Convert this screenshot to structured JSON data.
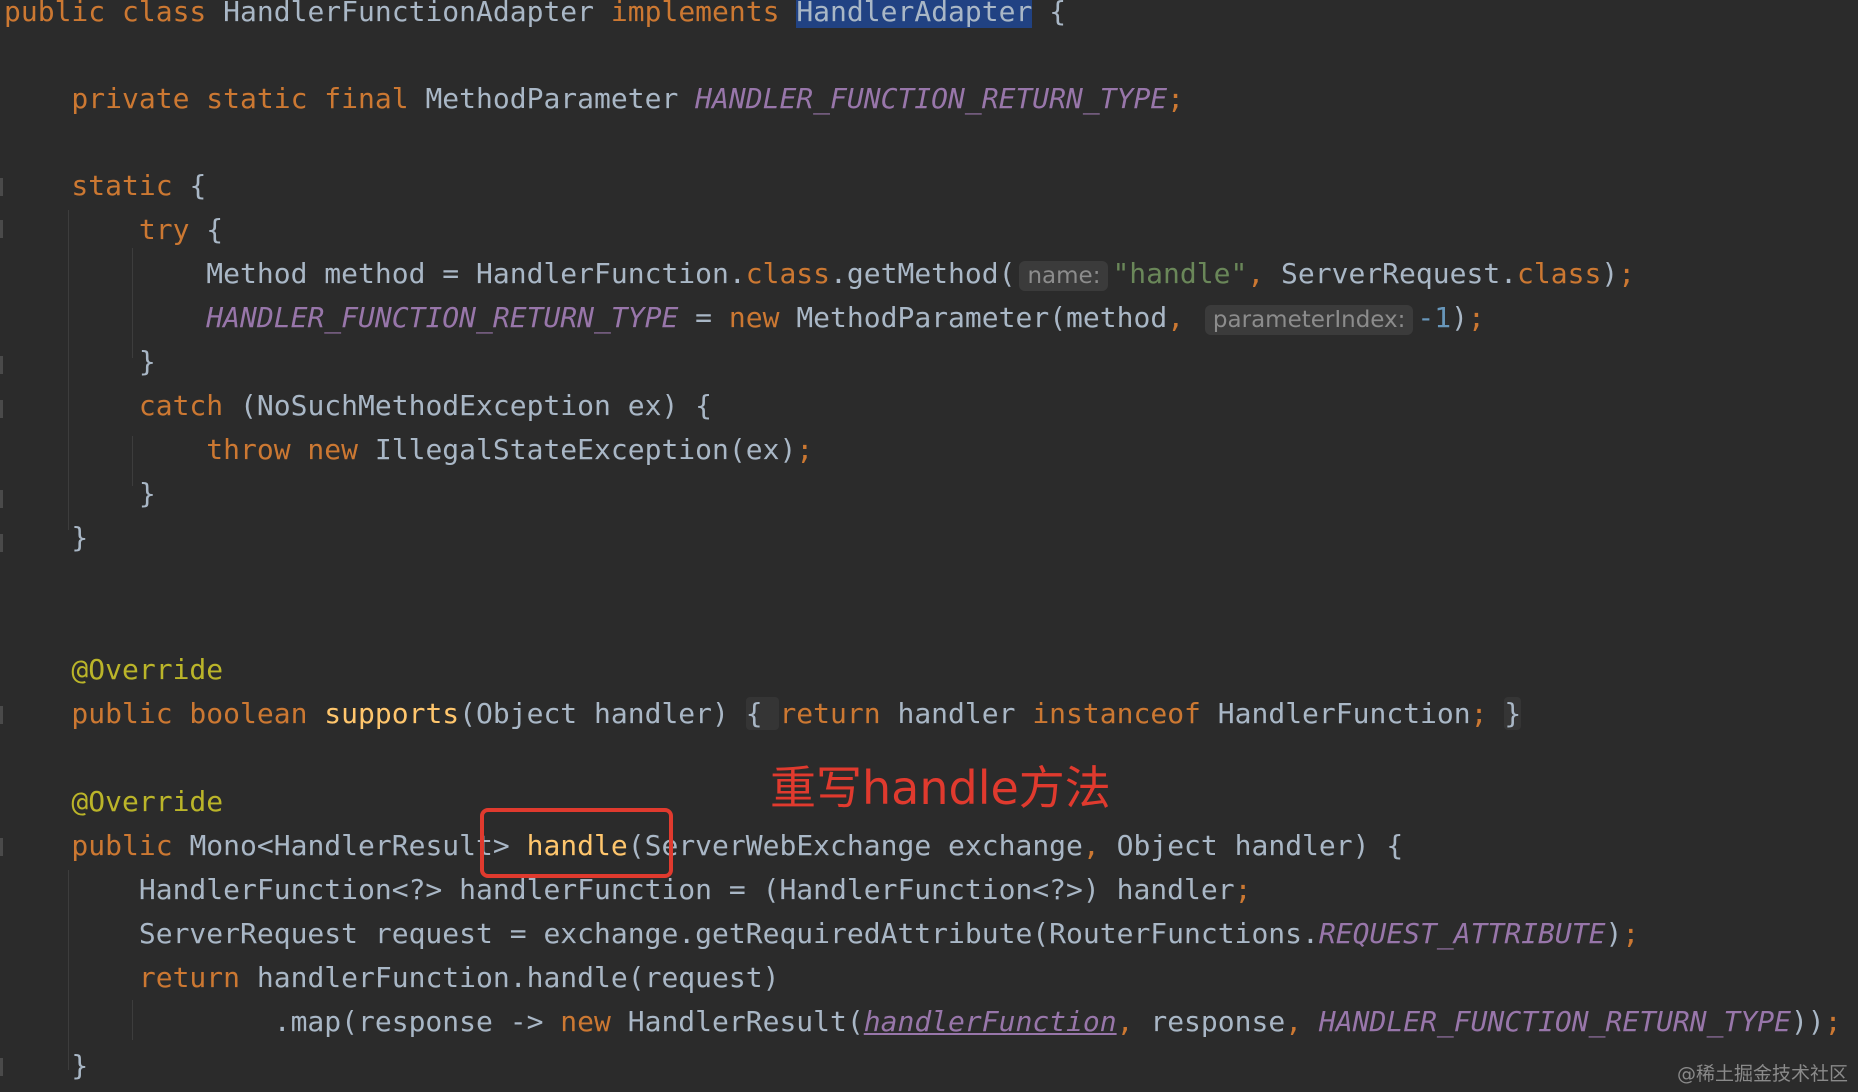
{
  "code_lines": [
    {
      "segments": [
        {
          "text": "public class ",
          "type": "kw"
        },
        {
          "text": "HandlerFunctionAdapter ",
          "type": "txt"
        },
        {
          "text": "implements ",
          "type": "kw"
        },
        {
          "text": "HandlerAdapter",
          "type": "sel"
        },
        {
          "text": " {",
          "type": "txt"
        }
      ]
    },
    {
      "segments": [
        {
          "text": "    private static final ",
          "type": "kw"
        },
        {
          "text": "MethodParameter ",
          "type": "txt"
        },
        {
          "text": "HANDLER_FUNCTION_RETURN_TYPE",
          "type": "cst"
        },
        {
          "text": ";",
          "type": "kw"
        }
      ]
    },
    {
      "segments": [
        {
          "text": "    static ",
          "type": "kw"
        },
        {
          "text": "{",
          "type": "txt"
        }
      ]
    },
    {
      "segments": [
        {
          "text": "        try ",
          "type": "kw"
        },
        {
          "text": "{",
          "type": "txt"
        }
      ]
    },
    {
      "segments": [
        {
          "text": "            Method method = HandlerFunction.",
          "type": "txt"
        },
        {
          "text": "class",
          "type": "kw"
        },
        {
          "text": ".getMethod(",
          "type": "txt"
        },
        {
          "text": "name:",
          "type": "hint"
        },
        {
          "text": "\"handle\"",
          "type": "str"
        },
        {
          "text": ", ",
          "type": "kw"
        },
        {
          "text": "ServerRequest.",
          "type": "txt"
        },
        {
          "text": "class",
          "type": "kw"
        },
        {
          "text": ")",
          "type": "txt"
        },
        {
          "text": ";",
          "type": "kw"
        }
      ]
    },
    {
      "segments": [
        {
          "text": "            ",
          "type": "txt"
        },
        {
          "text": "HANDLER_FUNCTION_RETURN_TYPE",
          "type": "cst"
        },
        {
          "text": " = ",
          "type": "txt"
        },
        {
          "text": "new ",
          "type": "kw"
        },
        {
          "text": "MethodParameter(method",
          "type": "txt"
        },
        {
          "text": ", ",
          "type": "kw"
        },
        {
          "text": "parameterIndex:",
          "type": "hint"
        },
        {
          "text": "-1",
          "type": "num"
        },
        {
          "text": ")",
          "type": "txt"
        },
        {
          "text": ";",
          "type": "kw"
        }
      ]
    },
    {
      "segments": [
        {
          "text": "        }",
          "type": "txt"
        }
      ]
    },
    {
      "segments": [
        {
          "text": "        catch ",
          "type": "kw"
        },
        {
          "text": "(NoSuchMethodException ex) {",
          "type": "txt"
        }
      ]
    },
    {
      "segments": [
        {
          "text": "            throw new ",
          "type": "kw"
        },
        {
          "text": "IllegalStateException(ex)",
          "type": "txt"
        },
        {
          "text": ";",
          "type": "kw"
        }
      ]
    },
    {
      "segments": [
        {
          "text": "        }",
          "type": "txt"
        }
      ]
    },
    {
      "segments": [
        {
          "text": "    }",
          "type": "txt"
        }
      ]
    },
    {
      "segments": [
        {
          "text": "    @Override",
          "type": "ann"
        }
      ]
    },
    {
      "segments": [
        {
          "text": "    public boolean ",
          "type": "kw"
        },
        {
          "text": "supports",
          "type": "fn"
        },
        {
          "text": "(Object handler) ",
          "type": "txt"
        },
        {
          "text": "{ ",
          "type": "fold"
        },
        {
          "text": "return ",
          "type": "kw"
        },
        {
          "text": "handler ",
          "type": "txt"
        },
        {
          "text": "instanceof ",
          "type": "kw"
        },
        {
          "text": "HandlerFunction",
          "type": "txt"
        },
        {
          "text": "; ",
          "type": "kw"
        },
        {
          "text": "}",
          "type": "fold"
        }
      ]
    },
    {
      "segments": [
        {
          "text": "    @Override",
          "type": "ann"
        }
      ]
    },
    {
      "segments": [
        {
          "text": "    public ",
          "type": "kw"
        },
        {
          "text": "Mono<HandlerResult> ",
          "type": "txt"
        },
        {
          "text": "handle",
          "type": "fn"
        },
        {
          "text": "(ServerWebExchange exchange",
          "type": "txt"
        },
        {
          "text": ", ",
          "type": "kw"
        },
        {
          "text": "Object handler) {",
          "type": "txt"
        }
      ]
    },
    {
      "segments": [
        {
          "text": "        HandlerFunction<?> handlerFunction = (HandlerFunction<?>) handler",
          "type": "txt"
        },
        {
          "text": ";",
          "type": "kw"
        }
      ]
    },
    {
      "segments": [
        {
          "text": "        ServerRequest request = exchange.getRequiredAttribute(RouterFunctions.",
          "type": "txt"
        },
        {
          "text": "REQUEST_ATTRIBUTE",
          "type": "cst"
        },
        {
          "text": ")",
          "type": "txt"
        },
        {
          "text": ";",
          "type": "kw"
        }
      ]
    },
    {
      "segments": [
        {
          "text": "        return ",
          "type": "kw"
        },
        {
          "text": "handlerFunction.handle(request)",
          "type": "txt"
        }
      ]
    },
    {
      "segments": [
        {
          "text": "                .map(response -> ",
          "type": "txt"
        },
        {
          "text": "new ",
          "type": "kw"
        },
        {
          "text": "HandlerResult(",
          "type": "txt"
        },
        {
          "text": "handlerFunction",
          "type": "cst-ul"
        },
        {
          "text": ", ",
          "type": "kw"
        },
        {
          "text": "response",
          "type": "txt"
        },
        {
          "text": ", ",
          "type": "kw"
        },
        {
          "text": "HANDLER_FUNCTION_RETURN_TYPE",
          "type": "cst"
        },
        {
          "text": "))",
          "type": "txt"
        },
        {
          "text": ";",
          "type": "kw"
        }
      ]
    },
    {
      "segments": [
        {
          "text": "    }",
          "type": "txt"
        }
      ]
    }
  ],
  "annotation": {
    "note": "重写handle方法",
    "color": "#e03a2e"
  },
  "watermark": "@稀土掘金技术社区",
  "colors": {
    "background": "#2b2b2b",
    "keyword": "#cc7832",
    "text": "#a9b7c6",
    "constant": "#9876aa",
    "string": "#6a8759",
    "number": "#6897bb",
    "annotation": "#bbb529",
    "method": "#ffc66d",
    "selection": "#214283"
  }
}
